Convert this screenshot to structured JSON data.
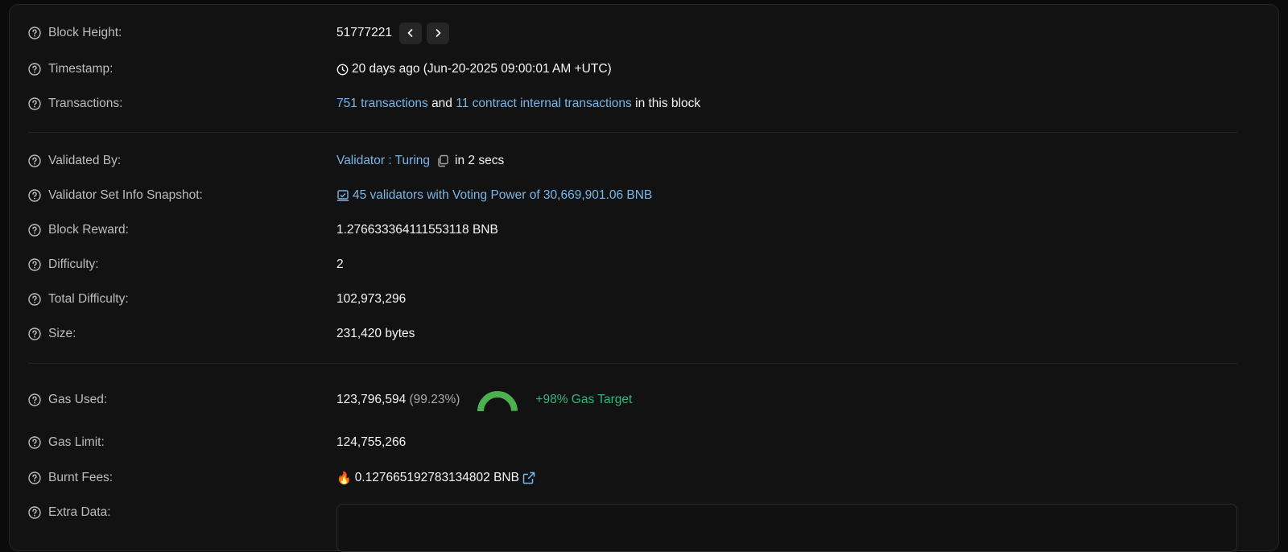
{
  "block_height": {
    "label": "Block Height:",
    "value": "51777221"
  },
  "timestamp": {
    "label": "Timestamp:",
    "value": "20 days ago (Jun-20-2025 09:00:01 AM +UTC)"
  },
  "transactions": {
    "label": "Transactions:",
    "tx_link": "751 transactions",
    "and": "and",
    "internal_link": "11 contract internal transactions",
    "suffix": "in this block"
  },
  "validated_by": {
    "label": "Validated By:",
    "link": "Validator : Turing",
    "suffix": "in 2 secs"
  },
  "validator_set": {
    "label": "Validator Set Info Snapshot:",
    "link": "45 validators with Voting Power of 30,669,901.06 BNB"
  },
  "block_reward": {
    "label": "Block Reward:",
    "value": "1.276633364111553118 BNB"
  },
  "difficulty": {
    "label": "Difficulty:",
    "value": "2"
  },
  "total_difficulty": {
    "label": "Total Difficulty:",
    "value": "102,973,296"
  },
  "size": {
    "label": "Size:",
    "value": "231,420 bytes"
  },
  "gas_used": {
    "label": "Gas Used:",
    "value": "123,796,594",
    "percent": "(99.23%)",
    "gauge_fraction": 0.9923,
    "target": "+98% Gas Target",
    "gauge_color": "#4caf50"
  },
  "gas_limit": {
    "label": "Gas Limit:",
    "value": "124,755,266"
  },
  "burnt_fees": {
    "label": "Burnt Fees:",
    "icon": "🔥",
    "value": "0.127665192783134802 BNB"
  },
  "extra_data": {
    "label": "Extra Data:",
    "value": ""
  },
  "colors": {
    "link": "#79b6e8",
    "accent_green": "#35b37e"
  }
}
